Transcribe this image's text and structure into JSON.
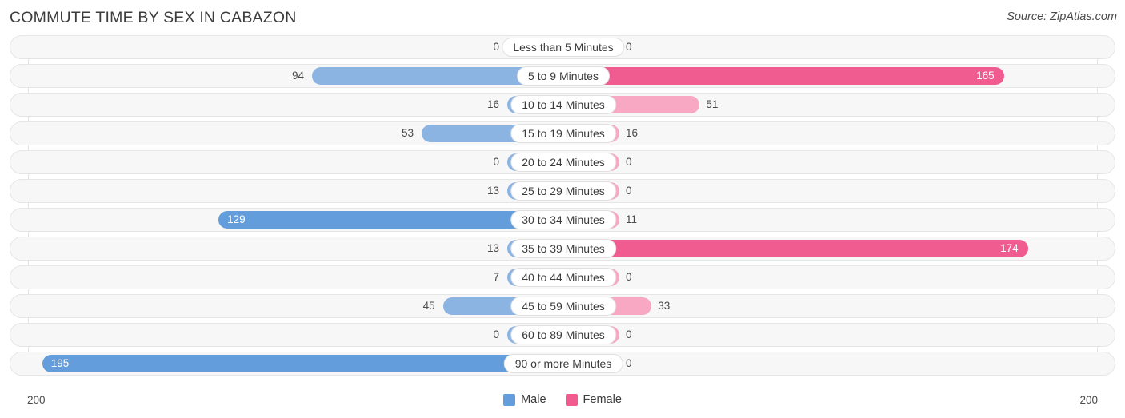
{
  "header": {
    "title": "COMMUTE TIME BY SEX IN CABAZON",
    "source": "Source: ZipAtlas.com"
  },
  "legend": {
    "male_label": "Male",
    "female_label": "Female",
    "male_color": "#639ddb",
    "female_color": "#f05c8f"
  },
  "axis": {
    "left_label": "200",
    "right_label": "200",
    "max": 200
  },
  "colors": {
    "male_light": "#8cb4e2",
    "male_dark": "#639ddb",
    "female_light": "#f9a8c4",
    "female_dark": "#f05c8f",
    "row_background": "#f7f7f7",
    "row_border": "#e6e6e6",
    "gridline": "#e3e3e3"
  },
  "chart_data": {
    "type": "bar",
    "title": "COMMUTE TIME BY SEX IN CABAZON",
    "subtitle": "Source: ZipAtlas.com",
    "orientation": "horizontal-diverging",
    "xlabel": "",
    "ylabel": "",
    "xlim": [
      200,
      200
    ],
    "grid": false,
    "legend_position": "bottom-center",
    "categories": [
      "Less than 5 Minutes",
      "5 to 9 Minutes",
      "10 to 14 Minutes",
      "15 to 19 Minutes",
      "20 to 24 Minutes",
      "25 to 29 Minutes",
      "30 to 34 Minutes",
      "35 to 39 Minutes",
      "40 to 44 Minutes",
      "45 to 59 Minutes",
      "60 to 89 Minutes",
      "90 or more Minutes"
    ],
    "series": [
      {
        "name": "Male",
        "color": "#639ddb",
        "values": [
          0,
          94,
          16,
          53,
          0,
          13,
          129,
          13,
          7,
          45,
          0,
          195
        ]
      },
      {
        "name": "Female",
        "color": "#f05c8f",
        "values": [
          0,
          165,
          51,
          16,
          0,
          0,
          11,
          174,
          0,
          33,
          0,
          0
        ]
      }
    ]
  },
  "rows": [
    {
      "label": "Less than 5 Minutes",
      "male": 0,
      "male_text": "0",
      "female": 0,
      "female_text": "0"
    },
    {
      "label": "5 to 9 Minutes",
      "male": 94,
      "male_text": "94",
      "female": 165,
      "female_text": "165"
    },
    {
      "label": "10 to 14 Minutes",
      "male": 16,
      "male_text": "16",
      "female": 51,
      "female_text": "51"
    },
    {
      "label": "15 to 19 Minutes",
      "male": 53,
      "male_text": "53",
      "female": 16,
      "female_text": "16"
    },
    {
      "label": "20 to 24 Minutes",
      "male": 0,
      "male_text": "0",
      "female": 0,
      "female_text": "0"
    },
    {
      "label": "25 to 29 Minutes",
      "male": 13,
      "male_text": "13",
      "female": 0,
      "female_text": "0"
    },
    {
      "label": "30 to 34 Minutes",
      "male": 129,
      "male_text": "129",
      "female": 11,
      "female_text": "11"
    },
    {
      "label": "35 to 39 Minutes",
      "male": 13,
      "male_text": "13",
      "female": 174,
      "female_text": "174"
    },
    {
      "label": "40 to 44 Minutes",
      "male": 7,
      "male_text": "7",
      "female": 0,
      "female_text": "0"
    },
    {
      "label": "45 to 59 Minutes",
      "male": 45,
      "male_text": "45",
      "female": 33,
      "female_text": "33"
    },
    {
      "label": "60 to 89 Minutes",
      "male": 0,
      "male_text": "0",
      "female": 0,
      "female_text": "0"
    },
    {
      "label": "90 or more Minutes",
      "male": 195,
      "male_text": "195",
      "female": 0,
      "female_text": "0"
    }
  ]
}
